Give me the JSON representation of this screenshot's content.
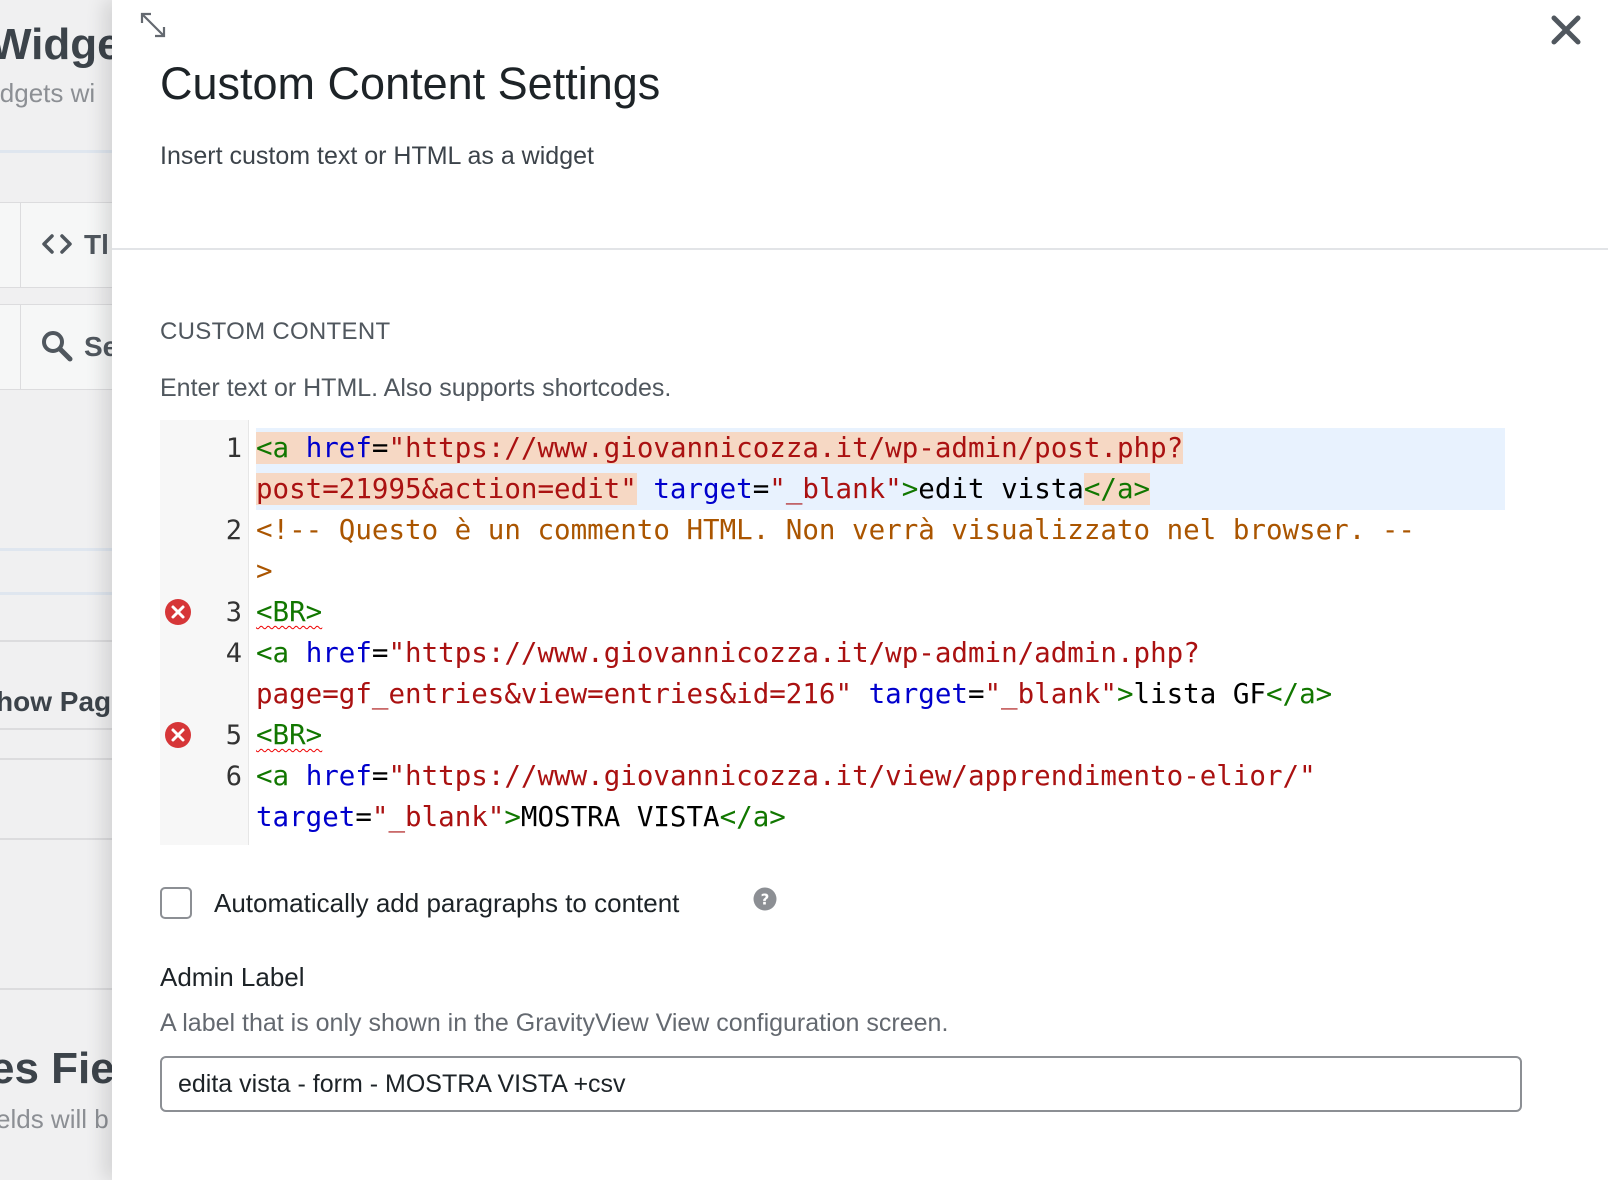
{
  "background": {
    "widgets_title": "Widget",
    "widgets_desc": "idgets wi",
    "tab_text_label": "Tl",
    "tab_search_label": "Se",
    "show_pages_label": "how Pag",
    "fields_title": "es Fiel",
    "fields_desc": "elds will b"
  },
  "modal": {
    "title": "Custom Content Settings",
    "subtitle": "Insert custom text or HTML as a widget",
    "section_heading": "CUSTOM CONTENT",
    "section_description": "Enter text or HTML. Also supports shortcodes.",
    "editor": {
      "line_numbers": [
        "1",
        "2",
        "3",
        "4",
        "5",
        "6"
      ],
      "line1": {
        "open": "<a",
        "attr_href": "href",
        "eq": "=",
        "href_value_a": "\"https://www.giovannicozza.it/wp-admin/post.php?",
        "href_value_b": "post=21995&action=edit\"",
        "attr_target": "target",
        "target_value": "\"_blank\"",
        "close_open": ">",
        "text": "edit vista",
        "end_tag": "</a>"
      },
      "line2": {
        "comment_a": "<!-- Questo è un commento HTML. Non verrà visualizzato nel browser. --",
        "comment_b": ">"
      },
      "line3": {
        "tag": "<BR>"
      },
      "line4": {
        "open": "<a",
        "attr_href": "href",
        "href_value_a": "\"https://www.giovannicozza.it/wp-admin/admin.php?",
        "href_value_b": "page=gf_entries&view=entries&id=216\"",
        "attr_target": "target",
        "target_value": "\"_blank\"",
        "text": "lista GF",
        "end_tag": "</a>"
      },
      "line5": {
        "tag": "<BR>"
      },
      "line6": {
        "open": "<a",
        "attr_href": "href",
        "href_value": "\"https://www.giovannicozza.it/view/apprendimento-elior/\"",
        "attr_target": "target",
        "target_value": "\"_blank\"",
        "text": "MOSTRA VISTA",
        "end_tag": "</a>"
      }
    },
    "checkbox_label": "Automatically add paragraphs to content",
    "admin_label_heading": "Admin Label",
    "admin_label_description": "A label that is only shown in the GravityView View configuration screen.",
    "admin_label_value": "edita vista - form - MOSTRA VISTA +csv"
  },
  "colors": {
    "tag": "#117700",
    "attribute": "#0000cc",
    "string": "#aa1111",
    "comment": "#aa5500",
    "error": "#d63638",
    "active_line": "#e8f2fe"
  },
  "icons": [
    "expand-icon",
    "close-icon",
    "error-icon",
    "help-icon",
    "code-icon",
    "search-icon"
  ]
}
